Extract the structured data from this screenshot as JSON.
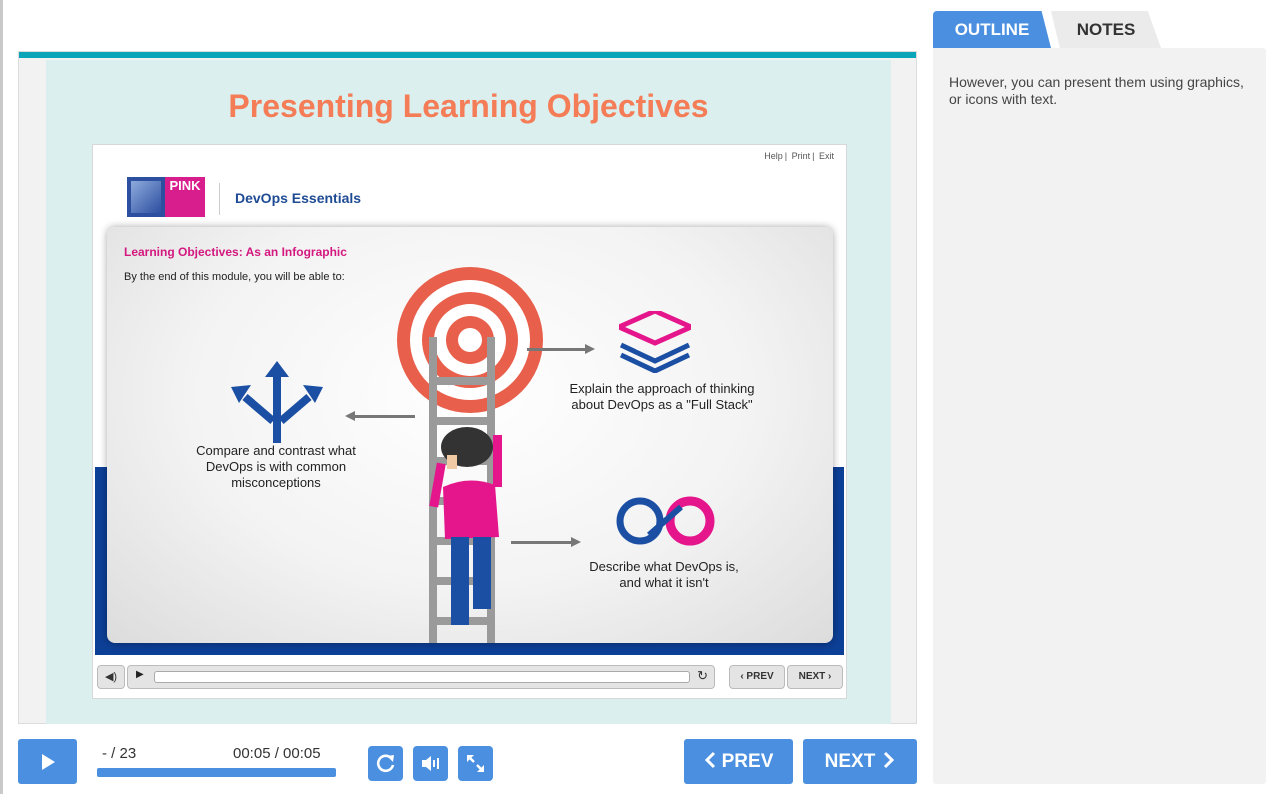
{
  "slide": {
    "title": "Presenting Learning Objectives",
    "screenshot": {
      "top_links": [
        "Help",
        "Print",
        "Exit"
      ],
      "logo_text": "PINK",
      "course_title": "DevOps Essentials",
      "heading": "Learning Objectives: As an Infographic",
      "subheading": "By the end of this module, you will be able to:",
      "objectives": [
        "Compare and contrast what DevOps is with common misconceptions",
        "Explain the approach of thinking about DevOps as a \"Full Stack\"",
        "Describe what DevOps is, and what it isn't"
      ],
      "inner_prev": "‹ PREV",
      "inner_next": "NEXT ›"
    }
  },
  "player": {
    "page_count": "- / 23",
    "time": "00:05 / 00:05",
    "progress_fraction": 1.0,
    "prev_label": "PREV",
    "next_label": "NEXT"
  },
  "sidebar": {
    "tabs": [
      {
        "label": "OUTLINE",
        "active": true
      },
      {
        "label": "NOTES",
        "active": false
      }
    ],
    "notes_text": "However, you can present them using graphics, or icons with text."
  },
  "colors": {
    "accent": "#4a8fe0",
    "title": "#f47c56",
    "magenta": "#d4187f",
    "navy": "#0c3f96"
  }
}
